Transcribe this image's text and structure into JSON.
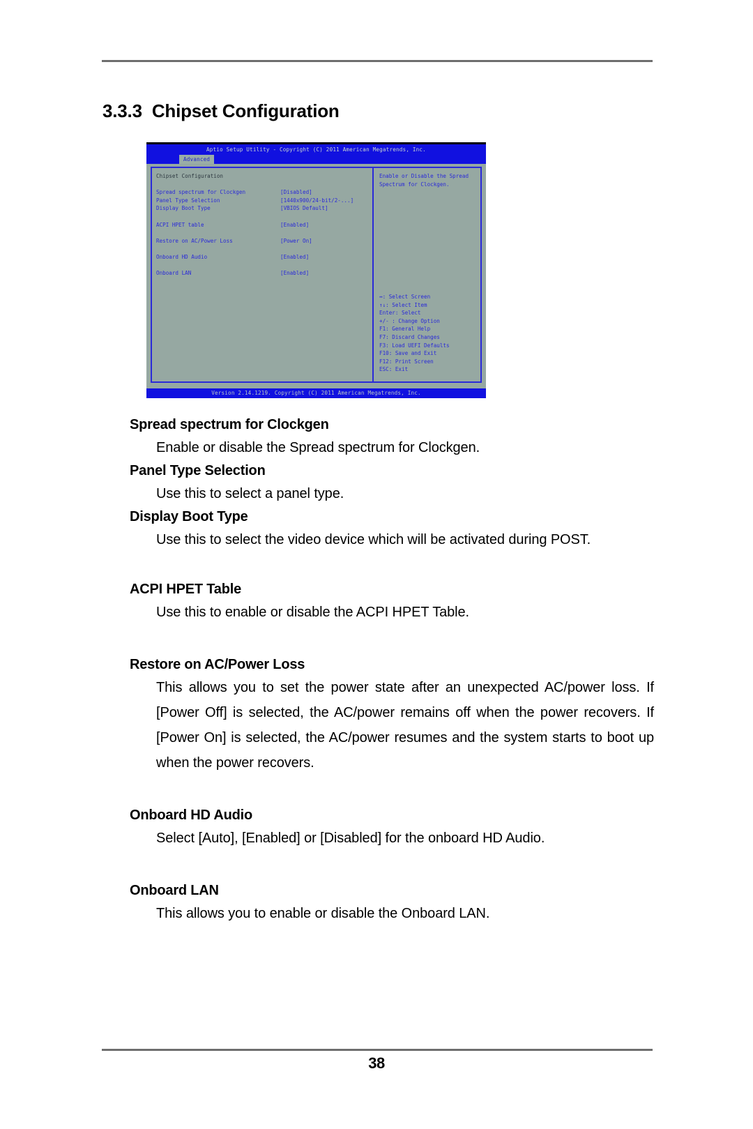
{
  "document": {
    "page_number": "38",
    "section_number": "3.3.3",
    "section_title": "Chipset Configuration"
  },
  "bios": {
    "title": "Aptio Setup Utility - Copyright (C) 2011 American Megatrends, Inc.",
    "tab": "Advanced",
    "menu_title": "Chipset Configuration",
    "items": [
      {
        "label": "Spread spectrum for Clockgen",
        "value": "[Disabled]"
      },
      {
        "label": "Panel Type Selection",
        "value": "[1440x900/24-bit/2-...]"
      },
      {
        "label": "Display Boot Type",
        "value": "[VBIOS Default]"
      },
      {
        "label": "ACPI HPET table",
        "value": "[Enabled]"
      },
      {
        "label": "Restore on AC/Power Loss",
        "value": "[Power On]"
      },
      {
        "label": "Onboard HD Audio",
        "value": "[Enabled]"
      },
      {
        "label": "Onboard LAN",
        "value": "[Enabled]"
      }
    ],
    "help_line1": "Enable or Disable the Spread",
    "help_line2": "Spectrum for Clockgen.",
    "keys": [
      "↔: Select Screen",
      "↑↓: Select Item",
      "Enter: Select",
      "+/- : Change Option",
      "F1: General Help",
      "F7: Discard Changes",
      "F3: Load UEFI Defaults",
      "F10: Save and Exit",
      "F12: Print Screen",
      "ESC: Exit"
    ],
    "footer": "Version 2.14.1219. Copyright (C) 2011 American Megatrends, Inc."
  },
  "entries": [
    {
      "term": "Spread spectrum for Clockgen",
      "desc": "Enable or disable the Spread spectrum for Clockgen."
    },
    {
      "term": "Panel Type Selection",
      "desc": "Use this to select a panel type."
    },
    {
      "term": "Display Boot Type",
      "desc": "Use this to select the video device which will be activated during POST."
    },
    {
      "term": "ACPI HPET Table",
      "desc": "Use this to enable or disable the ACPI HPET Table."
    },
    {
      "term": "Restore on AC/Power Loss",
      "desc": "This allows you to set the power state after an unexpected AC/power loss. If [Power Off] is selected, the AC/power remains off when the power recovers. If [Power On] is selected, the AC/power resumes and the system starts to boot up when the power recovers."
    },
    {
      "term": "Onboard HD Audio",
      "desc": "Select [Auto], [Enabled] or [Disabled] for the onboard HD Audio."
    },
    {
      "term": "Onboard LAN",
      "desc": "This allows you to enable or disable the Onboard LAN."
    }
  ]
}
